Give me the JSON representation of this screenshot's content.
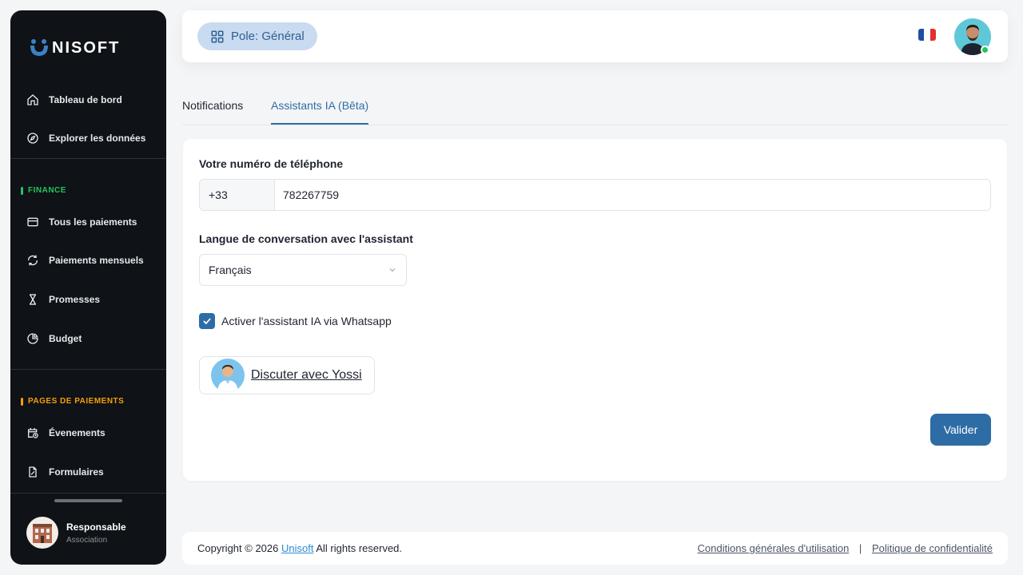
{
  "brand": {
    "logo_text": "NISOFT",
    "accent": "#2e6ca6"
  },
  "sidebar": {
    "top_items": [
      {
        "label": "Tableau de bord",
        "icon": "home-icon"
      },
      {
        "label": "Explorer les données",
        "icon": "compass-icon"
      }
    ],
    "finance": {
      "title": "FINANCE",
      "color": "#22c55e",
      "items": [
        {
          "label": "Tous les paiements",
          "icon": "credit-card-icon"
        },
        {
          "label": "Paiements mensuels",
          "icon": "refresh-icon"
        },
        {
          "label": "Promesses",
          "icon": "hourglass-icon"
        },
        {
          "label": "Budget",
          "icon": "pie-chart-icon"
        }
      ]
    },
    "payment_pages": {
      "title": "PAGES DE PAIEMENTS",
      "color": "#f59e0b",
      "items": [
        {
          "label": "Évenements",
          "icon": "calendar-clock-icon"
        },
        {
          "label": "Formulaires",
          "icon": "form-icon"
        }
      ]
    },
    "user": {
      "name": "Responsable",
      "role": "Association"
    }
  },
  "header": {
    "pole_label": "Pole: Général",
    "language_flag": "france-flag-icon"
  },
  "tabs": [
    {
      "label": "Notifications",
      "active": false
    },
    {
      "label": "Assistants IA (Bêta)",
      "active": true
    }
  ],
  "form": {
    "phone_label": "Votre numéro de téléphone",
    "phone_prefix": "+33",
    "phone_value": "782267759",
    "language_label": "Langue de conversation avec l'assistant",
    "language_value": "Français",
    "whatsapp_label": "Activer l'assistant IA via Whatsapp",
    "whatsapp_checked": true,
    "chat_label": "Discuter avec Yossi",
    "submit_label": "Valider"
  },
  "footer": {
    "copyright_prefix": "Copyright © 2026",
    "company_link": "Unisoft",
    "copyright_suffix": "All rights reserved.",
    "terms_link": "Conditions générales d'utilisation",
    "separator": "|",
    "privacy_link": "Politique de confidentialité"
  }
}
